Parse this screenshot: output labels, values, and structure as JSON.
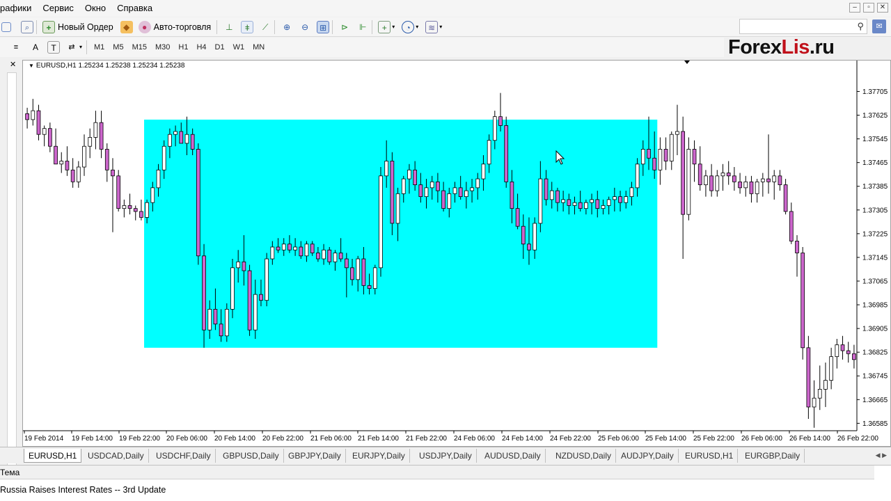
{
  "menu": [
    "рафики",
    "Сервис",
    "Окно",
    "Справка"
  ],
  "window_controls": [
    "–",
    "▫",
    "✕"
  ],
  "toolbar": {
    "new_order_label": "Новый Ордер",
    "autotrade_label": "Авто-торговля",
    "search_placeholder": ""
  },
  "timeframes": [
    "M1",
    "M5",
    "M15",
    "M30",
    "H1",
    "H4",
    "D1",
    "W1",
    "MN"
  ],
  "logo": {
    "part1": "Forex",
    "part2": "Lis",
    "part3": ".ru"
  },
  "chart": {
    "title": "EURUSD,H1  1.25234 1.25238 1.25234 1.25238"
  },
  "tabs": [
    {
      "label": "EURUSD,H1",
      "active": true
    },
    {
      "label": "USDCAD,Daily"
    },
    {
      "label": "USDCHF,Daily"
    },
    {
      "label": "GBPUSD,Daily"
    },
    {
      "label": "GBPJPY,Daily"
    },
    {
      "label": "EURJPY,Daily"
    },
    {
      "label": "USDJPY,Daily"
    },
    {
      "label": "AUDUSD,Daily"
    },
    {
      "label": "NZDUSD,Daily"
    },
    {
      "label": "AUDJPY,Daily"
    },
    {
      "label": "EURUSD,H1"
    },
    {
      "label": "EURGBP,Daily"
    }
  ],
  "news": {
    "header": "Тема",
    "row": "Russia Raises Interest Rates -- 3rd Update"
  },
  "chart_data": {
    "type": "candlestick",
    "symbol": "EURUSD",
    "timeframe": "H1",
    "y_ticks": [
      "1.37705",
      "1.37625",
      "1.37545",
      "1.37465",
      "1.37385",
      "1.37305",
      "1.37225",
      "1.37145",
      "1.37065",
      "1.36985",
      "1.36905",
      "1.36825",
      "1.36745",
      "1.36665",
      "1.36585"
    ],
    "x_ticks": [
      "19 Feb 2014",
      "19 Feb 14:00",
      "19 Feb 22:00",
      "20 Feb 06:00",
      "20 Feb 14:00",
      "20 Feb 22:00",
      "21 Feb 06:00",
      "21 Feb 14:00",
      "21 Feb 22:00",
      "24 Feb 06:00",
      "24 Feb 14:00",
      "24 Feb 22:00",
      "25 Feb 06:00",
      "25 Feb 14:00",
      "25 Feb 22:00",
      "26 Feb 06:00",
      "26 Feb 14:00",
      "26 Feb 22:00"
    ],
    "ylim": [
      1.3656,
      1.378
    ],
    "bull_color": "#ffffff",
    "bear_color": "#cc66cc",
    "highlight_color": "#00ffff",
    "highlight_range": {
      "from_index": 21,
      "to_index": 110,
      "price_high": 1.3761,
      "price_low": 1.3684
    },
    "candles": [
      [
        1.3763,
        1.3765,
        1.3758,
        1.3761
      ],
      [
        1.3761,
        1.3768,
        1.3759,
        1.3764
      ],
      [
        1.3764,
        1.3766,
        1.3754,
        1.3756
      ],
      [
        1.3756,
        1.3759,
        1.3752,
        1.3758
      ],
      [
        1.3758,
        1.376,
        1.375,
        1.3752
      ],
      [
        1.3752,
        1.3758,
        1.3746,
        1.3746
      ],
      [
        1.3746,
        1.375,
        1.3743,
        1.3747
      ],
      [
        1.3747,
        1.3752,
        1.3742,
        1.3744
      ],
      [
        1.3744,
        1.3748,
        1.3738,
        1.374
      ],
      [
        1.374,
        1.3747,
        1.3738,
        1.3745
      ],
      [
        1.3745,
        1.3756,
        1.3742,
        1.3752
      ],
      [
        1.3752,
        1.3758,
        1.3748,
        1.3755
      ],
      [
        1.3755,
        1.3764,
        1.3751,
        1.376
      ],
      [
        1.376,
        1.3764,
        1.3748,
        1.3751
      ],
      [
        1.3751,
        1.3753,
        1.374,
        1.3744
      ],
      [
        1.3744,
        1.3748,
        1.3723,
        1.3742
      ],
      [
        1.3742,
        1.3744,
        1.373,
        1.3731
      ],
      [
        1.3731,
        1.3734,
        1.3728,
        1.3732
      ],
      [
        1.3732,
        1.3736,
        1.3729,
        1.3731
      ],
      [
        1.3731,
        1.3732,
        1.3727,
        1.373
      ],
      [
        1.373,
        1.3734,
        1.3727,
        1.3728
      ],
      [
        1.3728,
        1.3734,
        1.3726,
        1.3733
      ],
      [
        1.3733,
        1.374,
        1.373,
        1.3738
      ],
      [
        1.3738,
        1.3746,
        1.3735,
        1.3744
      ],
      [
        1.3744,
        1.3754,
        1.3741,
        1.3752
      ],
      [
        1.3752,
        1.3758,
        1.3748,
        1.3756
      ],
      [
        1.3756,
        1.3759,
        1.3752,
        1.3757
      ],
      [
        1.3757,
        1.376,
        1.3754,
        1.3753
      ],
      [
        1.3753,
        1.3762,
        1.3749,
        1.3756
      ],
      [
        1.3756,
        1.3758,
        1.3749,
        1.3751
      ],
      [
        1.3751,
        1.3753,
        1.3712,
        1.3715
      ],
      [
        1.3715,
        1.3719,
        1.3684,
        1.369
      ],
      [
        1.369,
        1.37,
        1.3687,
        1.3697
      ],
      [
        1.3697,
        1.3704,
        1.369,
        1.3692
      ],
      [
        1.3692,
        1.3697,
        1.3686,
        1.3688
      ],
      [
        1.3688,
        1.3699,
        1.3686,
        1.3697
      ],
      [
        1.3697,
        1.3714,
        1.3694,
        1.3711
      ],
      [
        1.3711,
        1.3717,
        1.3706,
        1.3713
      ],
      [
        1.3713,
        1.3722,
        1.3705,
        1.371
      ],
      [
        1.371,
        1.3712,
        1.3688,
        1.369
      ],
      [
        1.369,
        1.3707,
        1.3687,
        1.3702
      ],
      [
        1.3702,
        1.3707,
        1.3698,
        1.37
      ],
      [
        1.37,
        1.3716,
        1.3698,
        1.3714
      ],
      [
        1.3714,
        1.372,
        1.3712,
        1.3718
      ],
      [
        1.3718,
        1.3721,
        1.3716,
        1.3717
      ],
      [
        1.3717,
        1.3721,
        1.3715,
        1.3719
      ],
      [
        1.3719,
        1.3722,
        1.3716,
        1.3717
      ],
      [
        1.3717,
        1.3721,
        1.3715,
        1.3718
      ],
      [
        1.3718,
        1.372,
        1.3714,
        1.3715
      ],
      [
        1.3715,
        1.372,
        1.3713,
        1.3719
      ],
      [
        1.3719,
        1.372,
        1.3715,
        1.3716
      ],
      [
        1.3716,
        1.3718,
        1.3713,
        1.3714
      ],
      [
        1.3714,
        1.3719,
        1.3712,
        1.3717
      ],
      [
        1.3717,
        1.3718,
        1.3712,
        1.3713
      ],
      [
        1.3713,
        1.3717,
        1.371,
        1.3716
      ],
      [
        1.3716,
        1.3721,
        1.3713,
        1.3714
      ],
      [
        1.3714,
        1.3716,
        1.3701,
        1.3711
      ],
      [
        1.3711,
        1.3714,
        1.3705,
        1.3707
      ],
      [
        1.3707,
        1.3715,
        1.3703,
        1.3714
      ],
      [
        1.3714,
        1.3718,
        1.3702,
        1.3705
      ],
      [
        1.3705,
        1.3709,
        1.3702,
        1.3704
      ],
      [
        1.3704,
        1.3712,
        1.3702,
        1.3711
      ],
      [
        1.3711,
        1.3745,
        1.3708,
        1.3742
      ],
      [
        1.3742,
        1.3754,
        1.3738,
        1.3747
      ],
      [
        1.3747,
        1.375,
        1.3722,
        1.3726
      ],
      [
        1.3726,
        1.3738,
        1.372,
        1.3736
      ],
      [
        1.3736,
        1.3742,
        1.3733,
        1.3741
      ],
      [
        1.3741,
        1.3746,
        1.3736,
        1.3744
      ],
      [
        1.3744,
        1.3747,
        1.3737,
        1.3739
      ],
      [
        1.3739,
        1.3743,
        1.3733,
        1.3735
      ],
      [
        1.3735,
        1.3741,
        1.3731,
        1.3738
      ],
      [
        1.3738,
        1.3742,
        1.3734,
        1.374
      ],
      [
        1.374,
        1.3743,
        1.3733,
        1.3737
      ],
      [
        1.3737,
        1.374,
        1.373,
        1.3731
      ],
      [
        1.3731,
        1.3738,
        1.3728,
        1.3736
      ],
      [
        1.3736,
        1.374,
        1.3733,
        1.3738
      ],
      [
        1.3738,
        1.3742,
        1.3734,
        1.3735
      ],
      [
        1.3735,
        1.374,
        1.3731,
        1.3737
      ],
      [
        1.3737,
        1.3741,
        1.3733,
        1.3738
      ],
      [
        1.3738,
        1.3743,
        1.3734,
        1.3741
      ],
      [
        1.3741,
        1.3749,
        1.3737,
        1.3746
      ],
      [
        1.3746,
        1.3756,
        1.3743,
        1.3754
      ],
      [
        1.3754,
        1.3764,
        1.3751,
        1.3762
      ],
      [
        1.3762,
        1.377,
        1.3757,
        1.3759
      ],
      [
        1.3759,
        1.3762,
        1.3738,
        1.374
      ],
      [
        1.374,
        1.3744,
        1.3726,
        1.3731
      ],
      [
        1.3731,
        1.3736,
        1.3724,
        1.3725
      ],
      [
        1.3725,
        1.3729,
        1.3714,
        1.3719
      ],
      [
        1.3719,
        1.3728,
        1.3712,
        1.3717
      ],
      [
        1.3717,
        1.3728,
        1.3714,
        1.3726
      ],
      [
        1.3726,
        1.3747,
        1.3723,
        1.3741
      ],
      [
        1.3741,
        1.3744,
        1.3732,
        1.3734
      ],
      [
        1.3734,
        1.374,
        1.3731,
        1.3737
      ],
      [
        1.3737,
        1.3738,
        1.373,
        1.3733
      ],
      [
        1.3733,
        1.3737,
        1.373,
        1.3734
      ],
      [
        1.3734,
        1.3736,
        1.3729,
        1.3732
      ],
      [
        1.3732,
        1.3735,
        1.3729,
        1.3733
      ],
      [
        1.3733,
        1.3737,
        1.373,
        1.3731
      ],
      [
        1.3731,
        1.3734,
        1.3729,
        1.3733
      ],
      [
        1.3733,
        1.3736,
        1.3729,
        1.3734
      ],
      [
        1.3734,
        1.3737,
        1.3728,
        1.3731
      ],
      [
        1.3731,
        1.3734,
        1.3729,
        1.3732
      ],
      [
        1.3732,
        1.3735,
        1.3729,
        1.3734
      ],
      [
        1.3734,
        1.3738,
        1.373,
        1.3735
      ],
      [
        1.3735,
        1.3737,
        1.373,
        1.3733
      ],
      [
        1.3733,
        1.3737,
        1.3731,
        1.3735
      ],
      [
        1.3735,
        1.374,
        1.3732,
        1.3738
      ],
      [
        1.3738,
        1.3748,
        1.3735,
        1.3746
      ],
      [
        1.3746,
        1.3754,
        1.3742,
        1.3751
      ],
      [
        1.3751,
        1.3762,
        1.3744,
        1.3748
      ],
      [
        1.3748,
        1.3757,
        1.3741,
        1.3744
      ],
      [
        1.3744,
        1.3755,
        1.3739,
        1.3751
      ],
      [
        1.3751,
        1.3755,
        1.3744,
        1.3747
      ],
      [
        1.3747,
        1.3757,
        1.3744,
        1.3756
      ],
      [
        1.3756,
        1.3766,
        1.3749,
        1.3757
      ],
      [
        1.3757,
        1.3762,
        1.3714,
        1.3729
      ],
      [
        1.3729,
        1.3755,
        1.3727,
        1.3751
      ],
      [
        1.3751,
        1.3754,
        1.374,
        1.3746
      ],
      [
        1.3746,
        1.3752,
        1.3737,
        1.3739
      ],
      [
        1.3739,
        1.3744,
        1.3735,
        1.3742
      ],
      [
        1.3742,
        1.3746,
        1.3735,
        1.3737
      ],
      [
        1.3737,
        1.3744,
        1.3735,
        1.3742
      ],
      [
        1.3742,
        1.3746,
        1.3737,
        1.3743
      ],
      [
        1.3743,
        1.3747,
        1.3739,
        1.3742
      ],
      [
        1.3742,
        1.3745,
        1.3737,
        1.374
      ],
      [
        1.374,
        1.3743,
        1.3736,
        1.3738
      ],
      [
        1.3738,
        1.3742,
        1.3735,
        1.374
      ],
      [
        1.374,
        1.3742,
        1.3733,
        1.3736
      ],
      [
        1.3736,
        1.3741,
        1.3733,
        1.374
      ],
      [
        1.374,
        1.3743,
        1.3735,
        1.3741
      ],
      [
        1.3741,
        1.3756,
        1.3736,
        1.374
      ],
      [
        1.374,
        1.3744,
        1.3734,
        1.3742
      ],
      [
        1.3742,
        1.3744,
        1.3737,
        1.3739
      ],
      [
        1.3739,
        1.3741,
        1.3729,
        1.373
      ],
      [
        1.373,
        1.3733,
        1.3719,
        1.372
      ],
      [
        1.372,
        1.3722,
        1.3708,
        1.3716
      ],
      [
        1.3716,
        1.3718,
        1.368,
        1.3684
      ],
      [
        1.3684,
        1.3688,
        1.366,
        1.3664
      ],
      [
        1.3664,
        1.3673,
        1.3657,
        1.3667
      ],
      [
        1.3667,
        1.3678,
        1.3663,
        1.367
      ],
      [
        1.367,
        1.3679,
        1.3664,
        1.3673
      ],
      [
        1.3673,
        1.3684,
        1.367,
        1.3681
      ],
      [
        1.3681,
        1.3687,
        1.3677,
        1.3685
      ],
      [
        1.3685,
        1.3688,
        1.368,
        1.3683
      ],
      [
        1.3683,
        1.3686,
        1.3679,
        1.3682
      ],
      [
        1.3682,
        1.3685,
        1.3677,
        1.368
      ]
    ]
  }
}
